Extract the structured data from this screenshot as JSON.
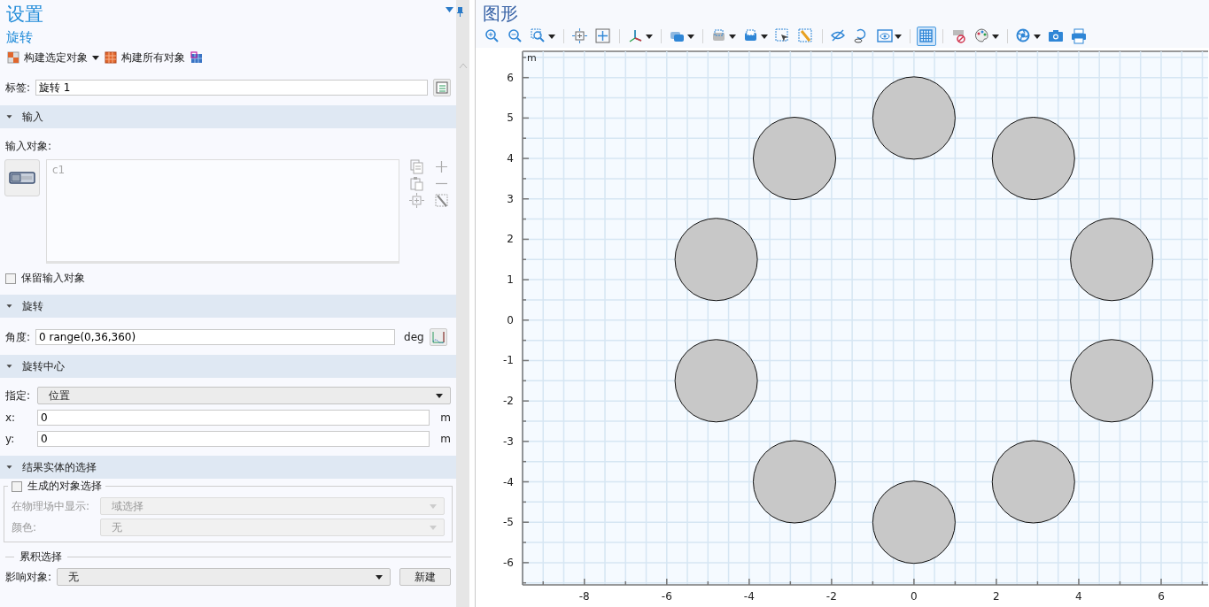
{
  "settings": {
    "title": "设置",
    "subtitle": "旋转",
    "toolbar": [
      {
        "label": "构建选定对象",
        "has_menu": true
      },
      {
        "label": "构建所有对象",
        "has_menu": false
      }
    ],
    "label_field": {
      "label": "标签:",
      "value": "旋转 1"
    },
    "sections": [
      {
        "kind": "input",
        "title": "输入",
        "expanded": true,
        "list_label": "输入对象:",
        "items": [
          "c1"
        ],
        "checkbox": {
          "label": "保留输入对象",
          "checked": false
        }
      },
      {
        "kind": "angle",
        "title": "旋转",
        "expanded": true,
        "label": "角度:",
        "value": "0 range(0,36,360)",
        "unit": "deg"
      },
      {
        "kind": "center",
        "title": "旋转中心",
        "expanded": true,
        "select": {
          "label": "指定:",
          "value": "位置"
        },
        "fields": [
          {
            "label": "x:",
            "value": "0",
            "unit": "m"
          },
          {
            "label": "y:",
            "value": "0",
            "unit": "m"
          }
        ]
      },
      {
        "kind": "selection",
        "title": "结果实体的选择",
        "expanded": true,
        "group": {
          "label": "生成的对象选择",
          "checked": false,
          "rows": [
            {
              "label": "在物理场中显示:",
              "value": "域选择",
              "disabled": true
            },
            {
              "label": "颜色:",
              "value": "无",
              "disabled": true
            }
          ]
        },
        "cumulative": {
          "title": "累积选择",
          "label": "影响对象:",
          "value": "无",
          "button": "新建"
        }
      }
    ]
  },
  "graphics": {
    "title": "图形",
    "chart_data": {
      "type": "scatter",
      "ylabel": "m",
      "grid": true,
      "x": [
        0,
        2.9,
        4.8,
        4.8,
        2.9,
        0,
        -2.9,
        -4.8,
        -4.8,
        -2.9
      ],
      "values": [
        5,
        4,
        1.5,
        -1.5,
        -4,
        -5,
        -4,
        -1.5,
        1.5,
        4
      ],
      "xlim": [
        -9.5,
        7.14
      ],
      "ylim": [
        -6.55,
        6.65
      ],
      "xticks": [
        -8,
        -6,
        -4,
        -2,
        0,
        2,
        4,
        6
      ],
      "yticks": [
        -6,
        -5,
        -4,
        -3,
        -2,
        -1,
        0,
        1,
        2,
        3,
        4,
        5,
        6
      ]
    }
  }
}
